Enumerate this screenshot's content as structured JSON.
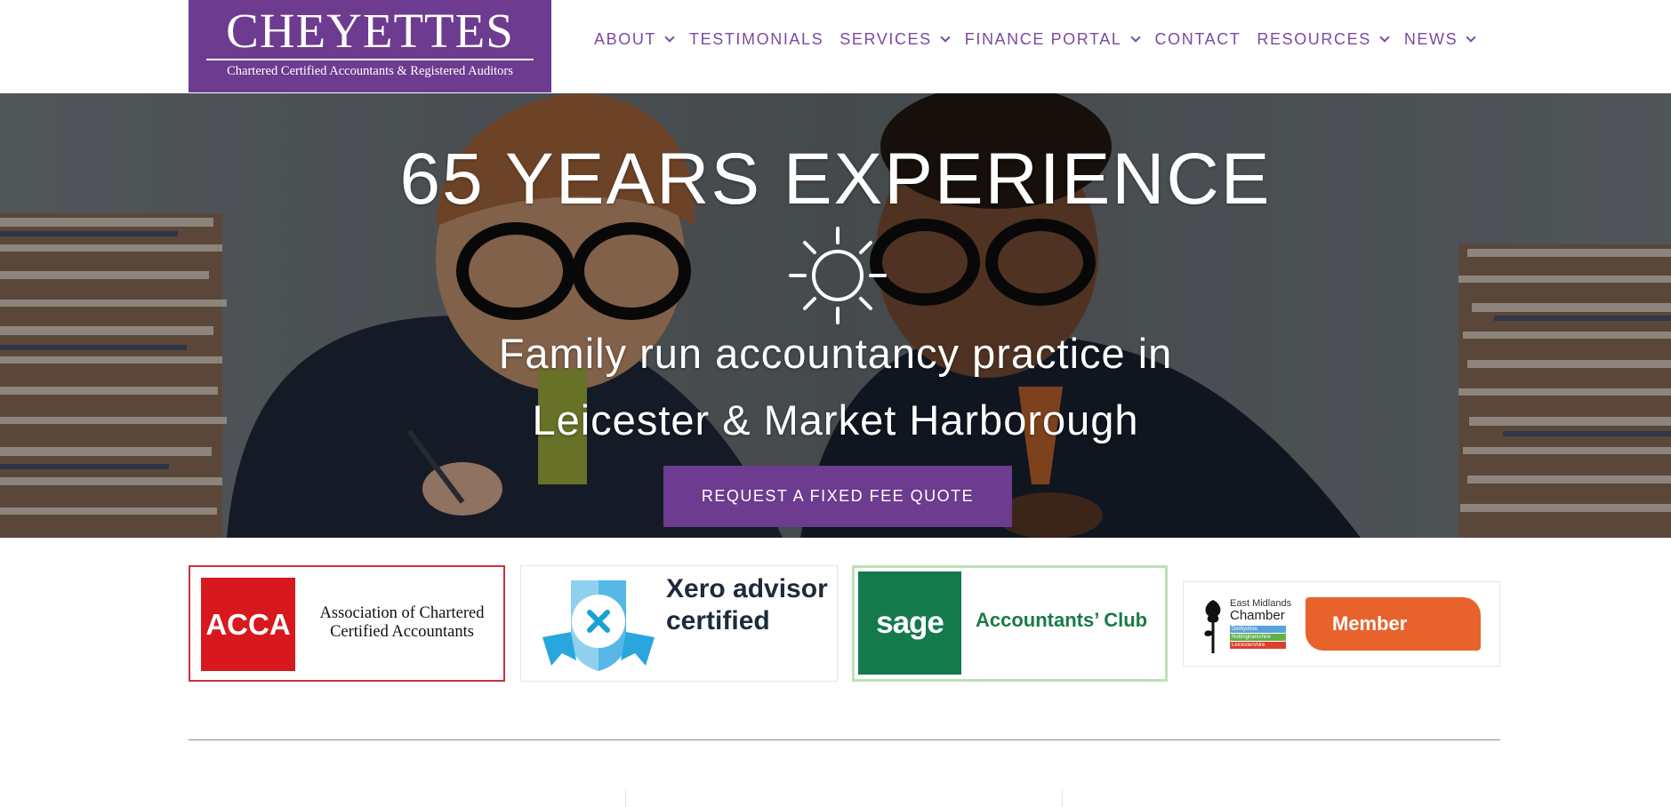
{
  "logo": {
    "name": "CHEYETTES",
    "tagline": "Chartered Certified Accountants & Registered Auditors"
  },
  "nav": [
    {
      "label": "ABOUT",
      "has_dropdown": true
    },
    {
      "label": "TESTIMONIALS",
      "has_dropdown": false
    },
    {
      "label": "SERVICES",
      "has_dropdown": true
    },
    {
      "label": "FINANCE PORTAL",
      "has_dropdown": true
    },
    {
      "label": "CONTACT",
      "has_dropdown": false
    },
    {
      "label": "RESOURCES",
      "has_dropdown": true
    },
    {
      "label": "NEWS",
      "has_dropdown": true
    }
  ],
  "hero": {
    "title": "65 YEARS EXPERIENCE",
    "icon": "sun-icon",
    "subtitle_line1": "Family run accountancy practice in",
    "subtitle_line2": "Leicester & Market Harborough",
    "cta_label": "REQUEST A FIXED FEE QUOTE"
  },
  "badges": {
    "acca": {
      "logo_text": "ACCA",
      "line1": "Association of Chartered",
      "line2": "Certified Accountants"
    },
    "xero": {
      "line1": "Xero advisor",
      "line2": "certified"
    },
    "sage": {
      "logo_text": "sage",
      "label": "Accountants’ Club"
    },
    "emc": {
      "line1": "East Midlands",
      "line2": "Chamber",
      "stripe1": "Derbyshire",
      "stripe2": "Nottinghamshire",
      "stripe3": "Leicestershire",
      "member_label": "Member"
    }
  },
  "colors": {
    "brand_purple": "#6d3b8f",
    "nav_purple": "#7b4aa3",
    "acca_red": "#d7191f",
    "sage_green": "#147a4c",
    "emc_orange": "#e7632b"
  }
}
